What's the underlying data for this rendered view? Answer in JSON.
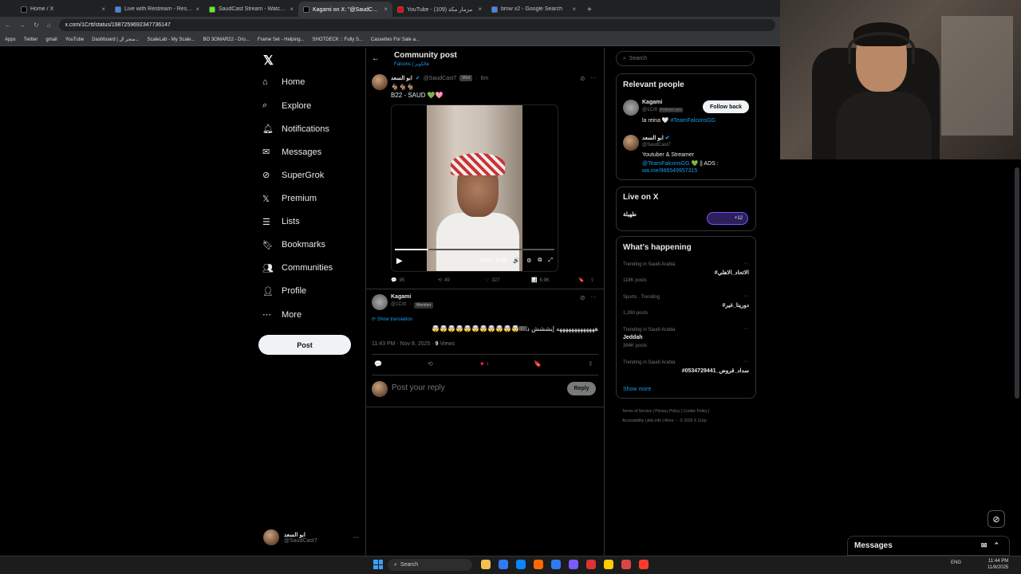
{
  "browser": {
    "tabs": [
      {
        "title": "Home / X",
        "color": "#000000",
        "active": false
      },
      {
        "title": "Live with Restream - Restream",
        "color": "#4285f4",
        "active": false
      },
      {
        "title": "SaudCast Stream - Watch Live",
        "color": "#53fc18",
        "active": false
      },
      {
        "title": "Kagami on X: \"@SaudCast7 😂",
        "color": "#000000",
        "active": true
      },
      {
        "title": "YouTube - مزمار مكة (109)",
        "color": "#ff0000",
        "active": false
      },
      {
        "title": "bmw x2 - Google Search",
        "color": "#4285f4",
        "active": false
      }
    ],
    "url": "x.com/1Crtt/status/1987259692347736147",
    "bookmarks": [
      "Apps",
      "Twitter",
      "gmail",
      "YouTube",
      "Dashboard | متجر ال...",
      "ScaleLab - My Scale...",
      "BO 3OMAR22 - Dro...",
      "Frame Set - Helping...",
      "SHOTDECK :: Fully S...",
      "Cassettes For Sale a..."
    ]
  },
  "nav": {
    "items": [
      {
        "label": "Home",
        "icon": "home-icon"
      },
      {
        "label": "Explore",
        "icon": "search-icon"
      },
      {
        "label": "Notifications",
        "icon": "bell-icon"
      },
      {
        "label": "Messages",
        "icon": "mail-icon"
      },
      {
        "label": "SuperGrok",
        "icon": "grok-icon"
      },
      {
        "label": "Premium",
        "icon": "x-logo-icon"
      },
      {
        "label": "Lists",
        "icon": "list-icon"
      },
      {
        "label": "Bookmarks",
        "icon": "bookmark-icon"
      },
      {
        "label": "Communities",
        "icon": "people-icon"
      },
      {
        "label": "Profile",
        "icon": "user-icon"
      },
      {
        "label": "More",
        "icon": "more-circle-icon"
      }
    ],
    "post_label": "Post",
    "account_name": "ابو السعد",
    "account_handle": "@SaudCast7"
  },
  "main": {
    "header_title": "Community post",
    "community": "Falcons | فالكونز",
    "post": {
      "author": "ابو السعد",
      "handle": "@SaudCast7",
      "badge": "Mod",
      "time": "6m",
      "text_line1": "🐐🐐🐐",
      "text_line2": "B22 - SAUD 💚🩷",
      "video_time": "0:06 / 0:29",
      "progress": 0.21,
      "replies": "95",
      "reposts": "49",
      "likes": "327",
      "views": "6.9K"
    },
    "reply": {
      "author": "Kagami",
      "handle": "@1Crtt",
      "badge": "Member",
      "show_translation": "Show translation",
      "text": "هههههههههههههه إيششش ذاllll🤯🤯🤯🤯🤯🤯🤯🤯🤯🤯🤯",
      "timestamp": "11:43 PM · Nov 8, 2025",
      "views_count": "9",
      "views_label": "Views",
      "likes": "1"
    },
    "reply_placeholder": "Post your reply",
    "reply_button": "Reply"
  },
  "sidebar": {
    "search_placeholder": "Search",
    "relevant_title": "Relevant people",
    "people": [
      {
        "name": "Kagami",
        "handle": "@1Crtt",
        "follows_you": "Follows you",
        "bio_text": "la reina 🤍 ",
        "bio_link": "#TeamFalconsGG",
        "follow_label": "Follow back"
      },
      {
        "name": "ابو السعد",
        "handle": "@SaudCast7",
        "bio_line1": "Youtuber & Streamer",
        "bio_link": "@TeamFalconsGG",
        "bio_rest": " 💚 || ADS :",
        "bio_link2": "wa.me/966549957315"
      }
    ],
    "live_title": "Live on X",
    "live_name": "طهيلة",
    "live_count": "+12",
    "happening_title": "What's happening",
    "trends": [
      {
        "context": "Trending in Saudi Arabia",
        "topic": "#الاتحاد_الاهلي",
        "posts": "118K posts"
      },
      {
        "context": "Sports · Trending",
        "topic": "#دورينا_غير",
        "posts": "1,260 posts"
      },
      {
        "context": "Trending in Saudi Arabia",
        "topic": "Jeddah",
        "posts": "394K posts"
      },
      {
        "context": "Trending in Saudi Arabia",
        "topic": "#سداد_قروض_0534729441",
        "posts": ""
      }
    ],
    "show_more": "Show more",
    "footer1": "Terms of Service | Privacy Policy | Cookie Policy |",
    "footer2": "Accessibility | Ads info | More ··· © 2025 X Corp."
  },
  "messages_drawer": "Messages",
  "taskbar": {
    "search": "Search",
    "lang": "ENG",
    "time": "11:44 PM",
    "date": "11/8/2025"
  }
}
